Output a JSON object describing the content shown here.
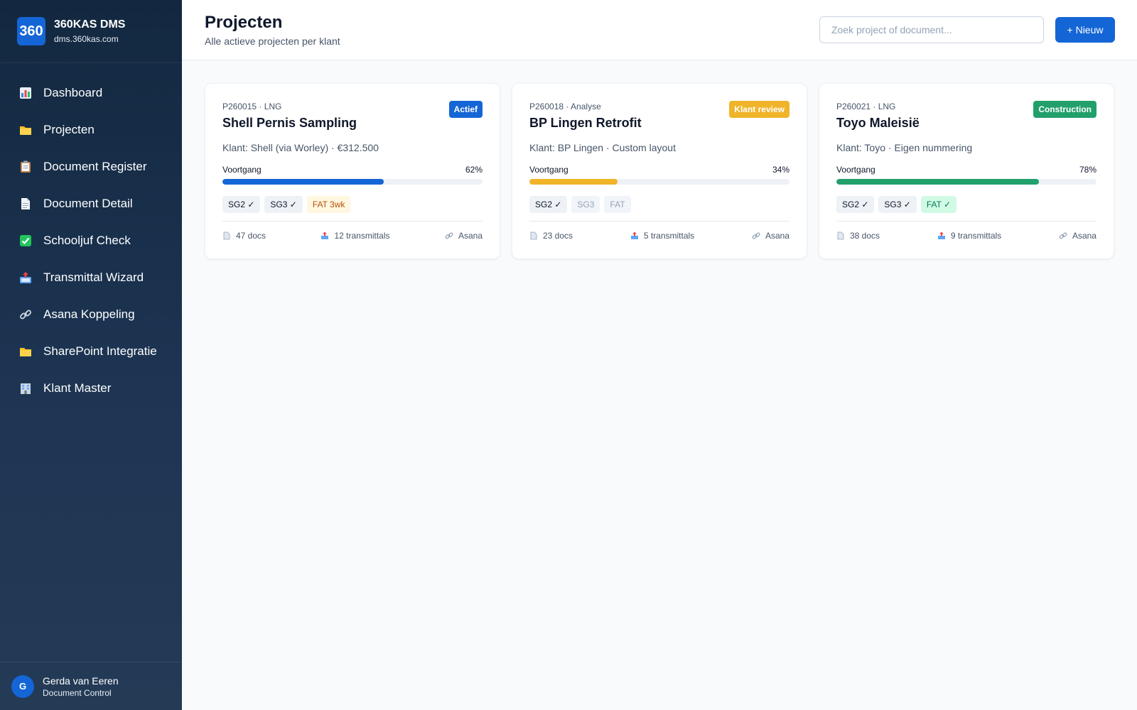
{
  "brand": {
    "logo_text": "360",
    "name": "360KAS DMS",
    "url": "dms.360kas.com"
  },
  "sidebar": {
    "items": [
      {
        "label": "Dashboard",
        "icon": "bar-chart-icon"
      },
      {
        "label": "Projecten",
        "icon": "folder-icon"
      },
      {
        "label": "Document Register",
        "icon": "clipboard-icon"
      },
      {
        "label": "Document Detail",
        "icon": "page-icon"
      },
      {
        "label": "Schooljuf Check",
        "icon": "check-box-icon"
      },
      {
        "label": "Transmittal Wizard",
        "icon": "outbox-icon"
      },
      {
        "label": "Asana Koppeling",
        "icon": "link-icon"
      },
      {
        "label": "SharePoint Integratie",
        "icon": "folder-icon"
      },
      {
        "label": "Klant Master",
        "icon": "building-icon"
      }
    ]
  },
  "user": {
    "initial": "G",
    "name": "Gerda van Eeren",
    "role": "Document Control"
  },
  "header": {
    "title": "Projecten",
    "subtitle": "Alle actieve projecten per klant",
    "search_placeholder": "Zoek project of document...",
    "new_button": "+ Nieuw"
  },
  "colors": {
    "accent": "#1466d6",
    "warning": "#f0b429",
    "success": "#22a06b"
  },
  "projects": [
    {
      "meta": "P260015 · LNG",
      "title": "Shell Pernis Sampling",
      "status": "Actief",
      "status_color": "#1466d6",
      "client": "Klant: Shell (via Worley) · €312.500",
      "progress_label": "Voortgang",
      "progress_text": "62%",
      "progress": 0.62,
      "progress_color": "#1466d6",
      "tags": [
        {
          "label": "SG2 ✓",
          "state": "done"
        },
        {
          "label": "SG3 ✓",
          "state": "done"
        },
        {
          "label": "FAT 3wk",
          "state": "warn"
        }
      ],
      "docs": "47 docs",
      "transmittals": "12 transmittals",
      "link": "Asana"
    },
    {
      "meta": "P260018 · Analyse",
      "title": "BP Lingen Retrofit",
      "status": "Klant review",
      "status_color": "#f0b429",
      "client": "Klant: BP Lingen · Custom layout",
      "progress_label": "Voortgang",
      "progress_text": "34%",
      "progress": 0.34,
      "progress_color": "#f0b429",
      "tags": [
        {
          "label": "SG2 ✓",
          "state": "done"
        },
        {
          "label": "SG3",
          "state": "pending"
        },
        {
          "label": "FAT",
          "state": "pending"
        }
      ],
      "docs": "23 docs",
      "transmittals": "5 transmittals",
      "link": "Asana"
    },
    {
      "meta": "P260021 · LNG",
      "title": "Toyo Maleisië",
      "status": "Construction",
      "status_color": "#22a06b",
      "client": "Klant: Toyo · Eigen nummering",
      "progress_label": "Voortgang",
      "progress_text": "78%",
      "progress": 0.78,
      "progress_color": "#22a06b",
      "tags": [
        {
          "label": "SG2 ✓",
          "state": "done"
        },
        {
          "label": "SG3 ✓",
          "state": "done"
        },
        {
          "label": "FAT ✓",
          "state": "ok"
        }
      ],
      "docs": "38 docs",
      "transmittals": "9 transmittals",
      "link": "Asana"
    }
  ]
}
